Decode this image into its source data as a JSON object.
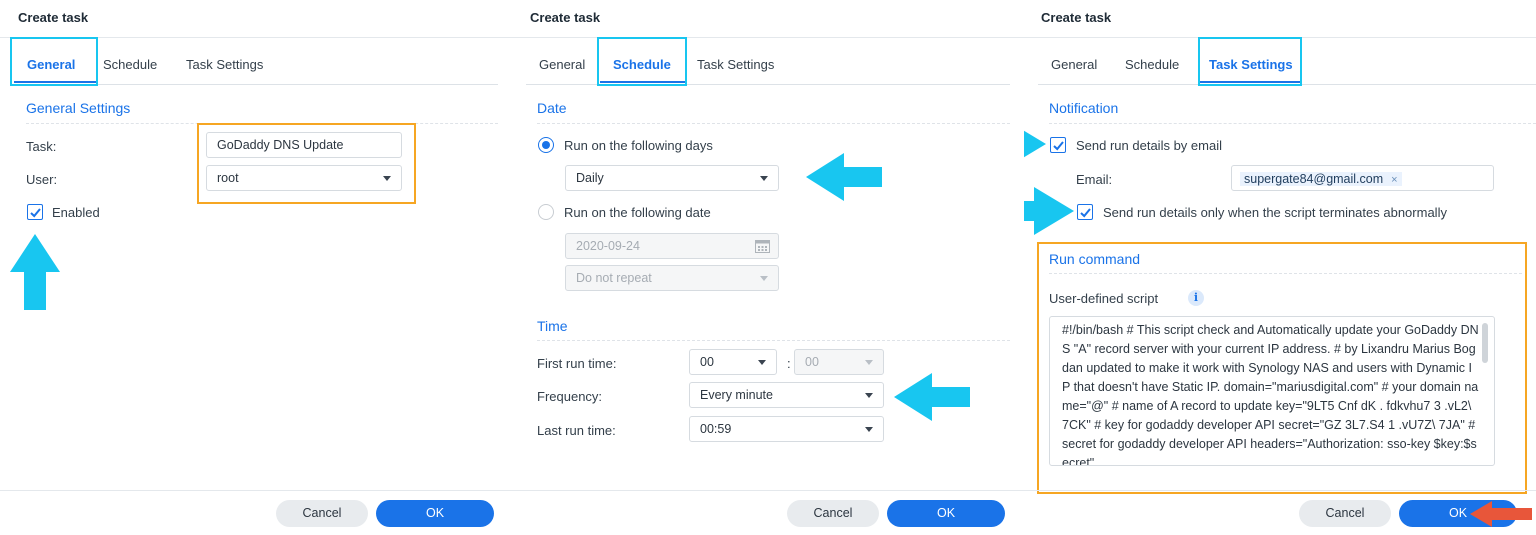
{
  "dialog_title": "Create task",
  "tabs": {
    "general": "General",
    "schedule": "Schedule",
    "task_settings": "Task Settings"
  },
  "general": {
    "section_title": "General Settings",
    "task_label": "Task:",
    "task_value": "GoDaddy DNS Update",
    "user_label": "User:",
    "user_value": "root",
    "enabled_label": "Enabled",
    "enabled_checked": true
  },
  "schedule": {
    "date_section": "Date",
    "run_days_label": "Run on the following days",
    "run_days_value": "Daily",
    "run_date_label": "Run on the following date",
    "run_date_value": "2020-09-24",
    "repeat_value": "Do not repeat",
    "time_section": "Time",
    "first_run_label": "First run time:",
    "first_run_hour": "00",
    "time_separator": ":",
    "first_run_minute": "00",
    "frequency_label": "Frequency:",
    "frequency_value": "Every minute",
    "last_run_label": "Last run time:",
    "last_run_value": "00:59"
  },
  "task_settings": {
    "notification_section": "Notification",
    "send_email_label": "Send run details by email",
    "email_label": "Email:",
    "email_value": "supergate84@gmail.com",
    "email_remove": "×",
    "abnormal_label": "Send run details only when the script terminates abnormally",
    "run_command_section": "Run command",
    "script_label": "User-defined script",
    "info_icon_glyph": "i",
    "script_text": "#!/bin/bash # This script check and Automatically update your GoDaddy DNS \"A\" record server with your current IP address. # by Lixandru Marius Bogdan updated to make it work with Synology NAS and users with Dynamic IP that doesn't have Static IP. domain=\"mariusdigital.com\" # your domain name=\"@\" # name of A record to update key=\"9LT5 Cnf dK . fdkvhu7 3 .vL2\\ 7CK\" # key for godaddy developer API secret=\"GZ 3L7.S4 1 .vU7Z\\ 7JA\" # secret for godaddy developer API headers=\"Authorization: sso-key $key:$secret\""
  },
  "buttons": {
    "cancel": "Cancel",
    "ok": "OK"
  },
  "colors": {
    "accent": "#1a73e8",
    "highlight_cyan": "#18c6f0",
    "highlight_orange": "#f6a623",
    "pointer_red": "#e8563a"
  }
}
